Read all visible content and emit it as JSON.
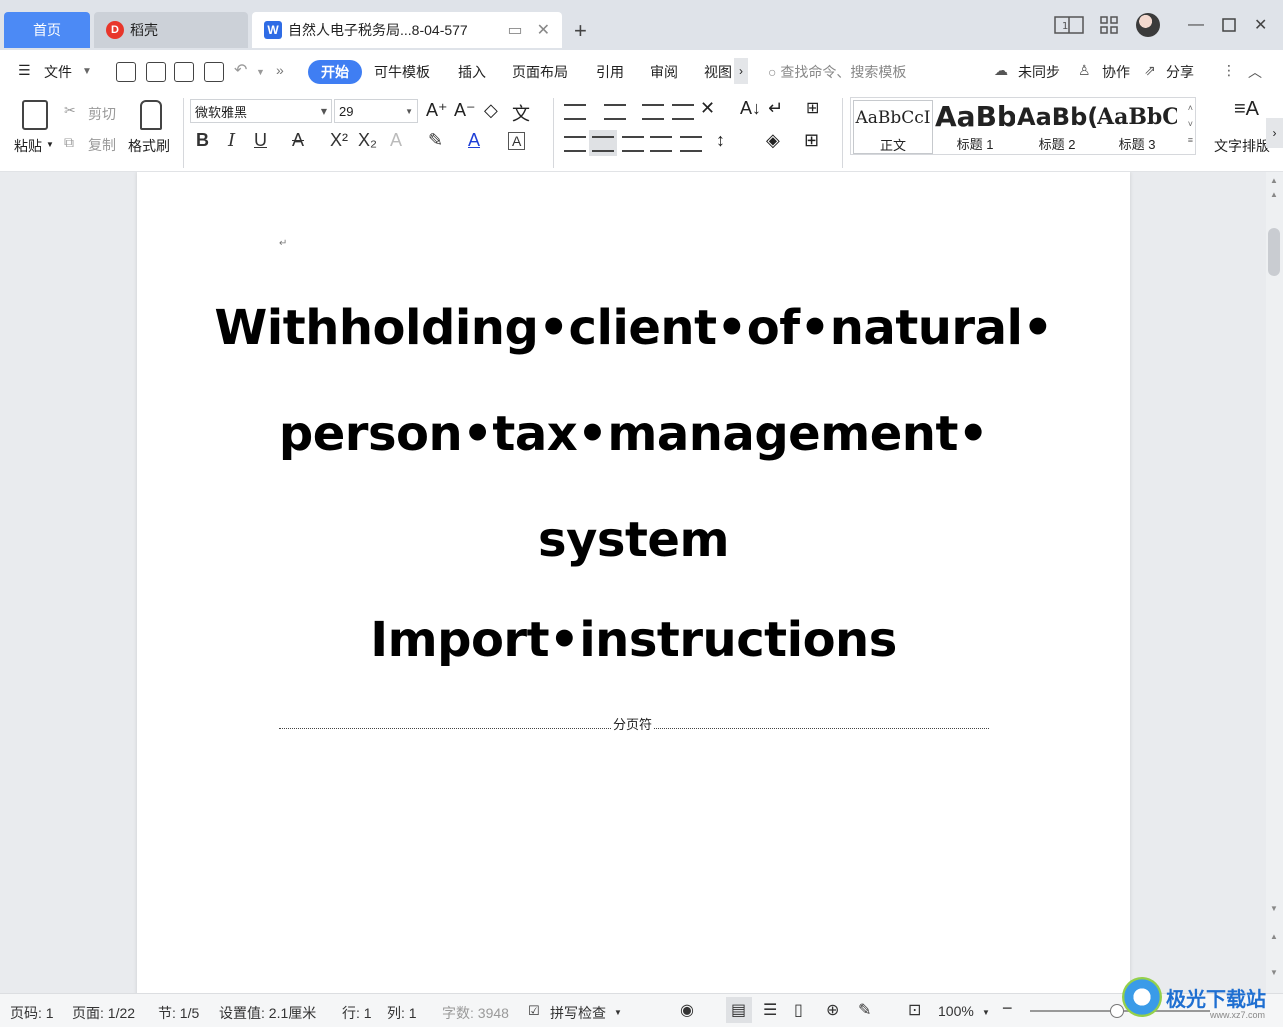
{
  "tabs": {
    "home": "首页",
    "daoke": "稻壳",
    "document": "自然人电子税务局...8-04-577"
  },
  "menu": {
    "file": "文件",
    "start": "开始",
    "template": "可牛模板",
    "insert": "插入",
    "layout": "页面布局",
    "reference": "引用",
    "review": "审阅",
    "view": "视图",
    "search_placeholder": "查找命令、搜索模板",
    "unsynced": "未同步",
    "collaborate": "协作",
    "share": "分享"
  },
  "ribbon": {
    "paste": "粘贴",
    "cut": "剪切",
    "copy": "复制",
    "format_painter": "格式刷",
    "font_name": "微软雅黑",
    "font_size": "29",
    "styles": [
      {
        "sample": "AaBbCcI",
        "label": "正文"
      },
      {
        "sample": "AaBb",
        "label": "标题 1"
      },
      {
        "sample": "AaBb(",
        "label": "标题 2"
      },
      {
        "sample": "AaBbC",
        "label": "标题 3"
      }
    ],
    "text_layout": "文字排版"
  },
  "document": {
    "title_lines": [
      "Withholding•client•of•natural•",
      "person•tax•management•",
      "system",
      "Import•instructions"
    ],
    "page_break_label": "分页符"
  },
  "status": {
    "page_num": "页码: 1",
    "pages": "页面: 1/22",
    "section": "节: 1/5",
    "setting": "设置值: 2.1厘米",
    "row": "行: 1",
    "col": "列: 1",
    "word_count": "字数: 3948",
    "spell_check": "拼写检查",
    "zoom": "100%"
  },
  "watermark": {
    "text": "极光下载站",
    "sub": "www.xz7.com"
  }
}
